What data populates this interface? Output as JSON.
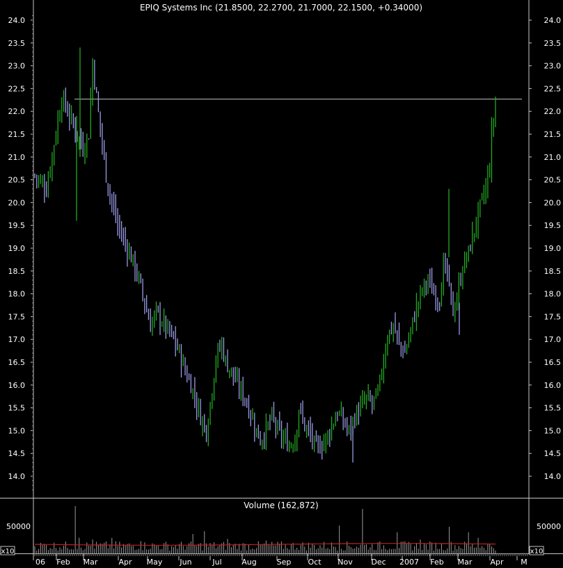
{
  "chart_data": [
    {
      "type": "candlestick",
      "title": "EPIQ Systems Inc (21.8500, 22.2700, 21.7000, 22.1500, +0.34000)",
      "ylim": [
        13.6,
        24.2
      ],
      "y_ticks": [
        "14.0",
        "14.5",
        "15.0",
        "15.5",
        "16.0",
        "16.5",
        "17.0",
        "17.5",
        "18.0",
        "18.5",
        "19.0",
        "19.5",
        "20.0",
        "20.5",
        "21.0",
        "21.5",
        "22.0",
        "22.5",
        "23.0",
        "23.5",
        "24.0"
      ],
      "x_ticks": [
        "06",
        "Feb",
        "Mar",
        "Apr",
        "May",
        "Jun",
        "Jul",
        "Aug",
        "Sep",
        "Oct",
        "Nov",
        "Dec",
        "2007",
        "Feb",
        "Mar",
        "Apr",
        "M"
      ],
      "reference_line": 22.27,
      "up_color": "#22aa22",
      "down_color": "#9a9ae8",
      "path_key_points": [
        [
          0,
          20.6
        ],
        [
          6,
          20.3
        ],
        [
          10,
          21.3
        ],
        [
          14,
          22.3
        ],
        [
          17,
          22.0
        ],
        [
          20,
          21.7
        ],
        [
          23,
          21.4
        ],
        [
          25,
          21.2
        ],
        [
          28,
          21.5
        ],
        [
          30,
          23.1
        ],
        [
          32,
          22.3
        ],
        [
          35,
          21.3
        ],
        [
          37,
          20.6
        ],
        [
          40,
          20.0
        ],
        [
          43,
          19.5
        ],
        [
          46,
          19.2
        ],
        [
          49,
          18.9
        ],
        [
          51,
          18.7
        ],
        [
          54,
          18.3
        ],
        [
          57,
          17.8
        ],
        [
          60,
          17.3
        ],
        [
          63,
          17.6
        ],
        [
          66,
          17.4
        ],
        [
          69,
          17.2
        ],
        [
          72,
          17.0
        ],
        [
          75,
          16.7
        ],
        [
          78,
          16.3
        ],
        [
          81,
          16.0
        ],
        [
          84,
          15.6
        ],
        [
          86,
          15.3
        ],
        [
          89,
          15.0
        ],
        [
          91,
          15.6
        ],
        [
          94,
          16.6
        ],
        [
          97,
          16.9
        ],
        [
          99,
          16.5
        ],
        [
          102,
          16.3
        ],
        [
          105,
          16.0
        ],
        [
          108,
          15.8
        ],
        [
          111,
          15.5
        ],
        [
          114,
          15.1
        ],
        [
          117,
          14.8
        ],
        [
          120,
          15.0
        ],
        [
          123,
          15.3
        ],
        [
          126,
          15.0
        ],
        [
          129,
          14.8
        ],
        [
          132,
          14.7
        ],
        [
          135,
          14.8
        ],
        [
          137,
          15.5
        ],
        [
          140,
          15.1
        ],
        [
          143,
          14.9
        ],
        [
          146,
          14.6
        ],
        [
          149,
          14.7
        ],
        [
          152,
          14.9
        ],
        [
          155,
          15.2
        ],
        [
          157,
          15.4
        ],
        [
          160,
          15.2
        ],
        [
          163,
          15.0
        ],
        [
          166,
          15.3
        ],
        [
          169,
          15.5
        ],
        [
          172,
          15.7
        ],
        [
          175,
          15.6
        ],
        [
          178,
          15.8
        ],
        [
          180,
          16.3
        ],
        [
          183,
          17.1
        ],
        [
          186,
          17.3
        ],
        [
          189,
          16.9
        ],
        [
          192,
          16.7
        ],
        [
          195,
          17.2
        ],
        [
          198,
          17.7
        ],
        [
          201,
          18.1
        ],
        [
          204,
          18.3
        ],
        [
          207,
          18.0
        ],
        [
          210,
          17.9
        ],
        [
          212,
          18.6
        ],
        [
          214,
          18.4
        ],
        [
          217,
          17.6
        ],
        [
          219,
          17.9
        ],
        [
          222,
          18.6
        ],
        [
          225,
          18.9
        ],
        [
          228,
          19.4
        ],
        [
          231,
          19.9
        ],
        [
          234,
          20.3
        ],
        [
          236,
          20.8
        ],
        [
          237,
          21.5
        ],
        [
          239,
          22.1
        ]
      ]
    },
    {
      "type": "bar",
      "title": "Volume (162,872)",
      "y_tick": "50000",
      "ylim": [
        0,
        95000
      ],
      "multiplier_label": "x10",
      "bar_color": "#9a9a9a",
      "ma_color": "#c02020",
      "avg_volume": 16287,
      "spikes": [
        [
          21,
          85000
        ],
        [
          23,
          28000
        ],
        [
          30,
          25000
        ],
        [
          40,
          28000
        ],
        [
          55,
          22000
        ],
        [
          82,
          35000
        ],
        [
          88,
          40000
        ],
        [
          100,
          26000
        ],
        [
          120,
          23000
        ],
        [
          158,
          50000
        ],
        [
          170,
          80000
        ],
        [
          188,
          38000
        ],
        [
          200,
          25000
        ],
        [
          215,
          48000
        ],
        [
          225,
          38000
        ],
        [
          230,
          28000
        ]
      ]
    }
  ]
}
